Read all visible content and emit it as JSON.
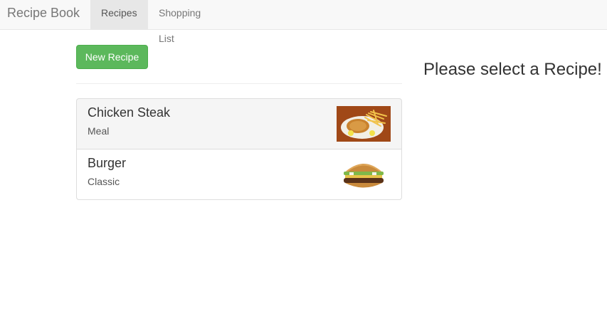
{
  "navbar": {
    "brand": "Recipe Book",
    "tabs": [
      {
        "label": "Recipes",
        "active": true
      },
      {
        "label": "Shopping List",
        "active": false
      }
    ]
  },
  "toolbar": {
    "new_recipe_label": "New Recipe"
  },
  "recipes": [
    {
      "name": "Chicken Steak",
      "description": "Meal",
      "image": "chicken-steak-photo",
      "selected": true
    },
    {
      "name": "Burger",
      "description": "Classic",
      "image": "burger-photo",
      "selected": false
    }
  ],
  "detail": {
    "placeholder": "Please select a Recipe!"
  },
  "colors": {
    "accent_green": "#5cb85c",
    "navbar_bg": "#f8f8f8",
    "active_tab_bg": "#e7e7e7"
  }
}
